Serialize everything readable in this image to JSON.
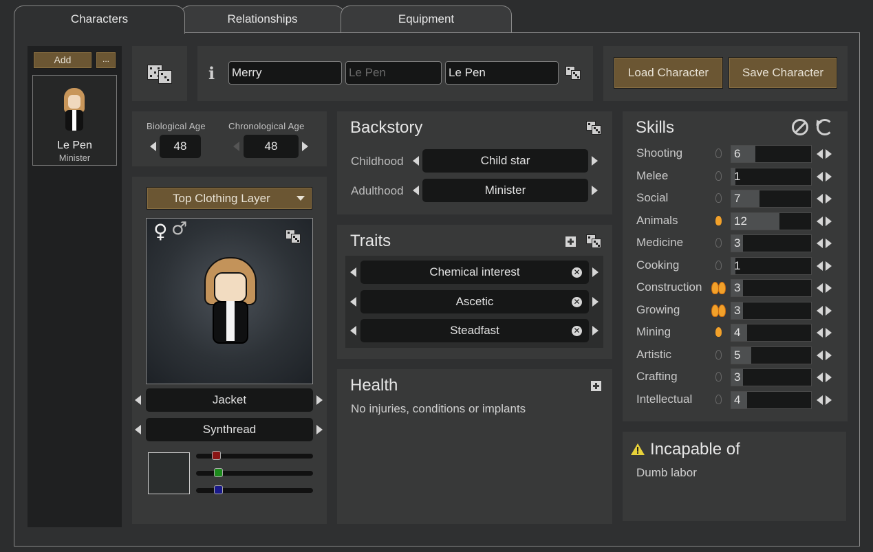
{
  "tabs": [
    {
      "label": "Characters",
      "active": true
    },
    {
      "label": "Relationships",
      "active": false
    },
    {
      "label": "Equipment",
      "active": false
    }
  ],
  "sidebar": {
    "add_label": "Add",
    "more_label": "...",
    "character": {
      "name": "Le Pen",
      "title": "Minister"
    }
  },
  "name_fields": {
    "first": {
      "value": "Merry",
      "placeholder": ""
    },
    "nick": {
      "value": "",
      "placeholder": "Le Pen"
    },
    "last": {
      "value": "Le Pen",
      "placeholder": ""
    }
  },
  "actions": {
    "load_label": "Load Character",
    "save_label": "Save Character"
  },
  "ages": {
    "biological_label": "Biological Age",
    "biological_value": "48",
    "chronological_label": "Chronological Age",
    "chronological_value": "48"
  },
  "appearance": {
    "layer_select": "Top Clothing Layer",
    "gender_female": "♀",
    "gender_male": "♂",
    "apparel": "Jacket",
    "material": "Synthread",
    "color_swatch": "#2b2e2e",
    "rgb": {
      "r": 0.17,
      "g": 0.19,
      "b": 0.19
    }
  },
  "backstory": {
    "title": "Backstory",
    "childhood_label": "Childhood",
    "childhood_value": "Child star",
    "adulthood_label": "Adulthood",
    "adulthood_value": "Minister"
  },
  "traits": {
    "title": "Traits",
    "items": [
      "Chemical interest",
      "Ascetic",
      "Steadfast"
    ]
  },
  "health": {
    "title": "Health",
    "status": "No injuries, conditions or implants"
  },
  "skills": {
    "title": "Skills",
    "items": [
      {
        "name": "Shooting",
        "value": "6",
        "passion": "none"
      },
      {
        "name": "Melee",
        "value": "1",
        "passion": "none"
      },
      {
        "name": "Social",
        "value": "7",
        "passion": "none"
      },
      {
        "name": "Animals",
        "value": "12",
        "passion": "minor"
      },
      {
        "name": "Medicine",
        "value": "3",
        "passion": "none"
      },
      {
        "name": "Cooking",
        "value": "1",
        "passion": "none"
      },
      {
        "name": "Construction",
        "value": "3",
        "passion": "major"
      },
      {
        "name": "Growing",
        "value": "3",
        "passion": "major"
      },
      {
        "name": "Mining",
        "value": "4",
        "passion": "minor"
      },
      {
        "name": "Artistic",
        "value": "5",
        "passion": "none"
      },
      {
        "name": "Crafting",
        "value": "3",
        "passion": "none"
      },
      {
        "name": "Intellectual",
        "value": "4",
        "passion": "none"
      }
    ]
  },
  "incapable": {
    "title": "Incapable of",
    "items": [
      "Dumb labor"
    ]
  },
  "colors": {
    "accent_gold": "#6b5633",
    "flame": "#f2a12a",
    "warning": "#e8d23a"
  }
}
